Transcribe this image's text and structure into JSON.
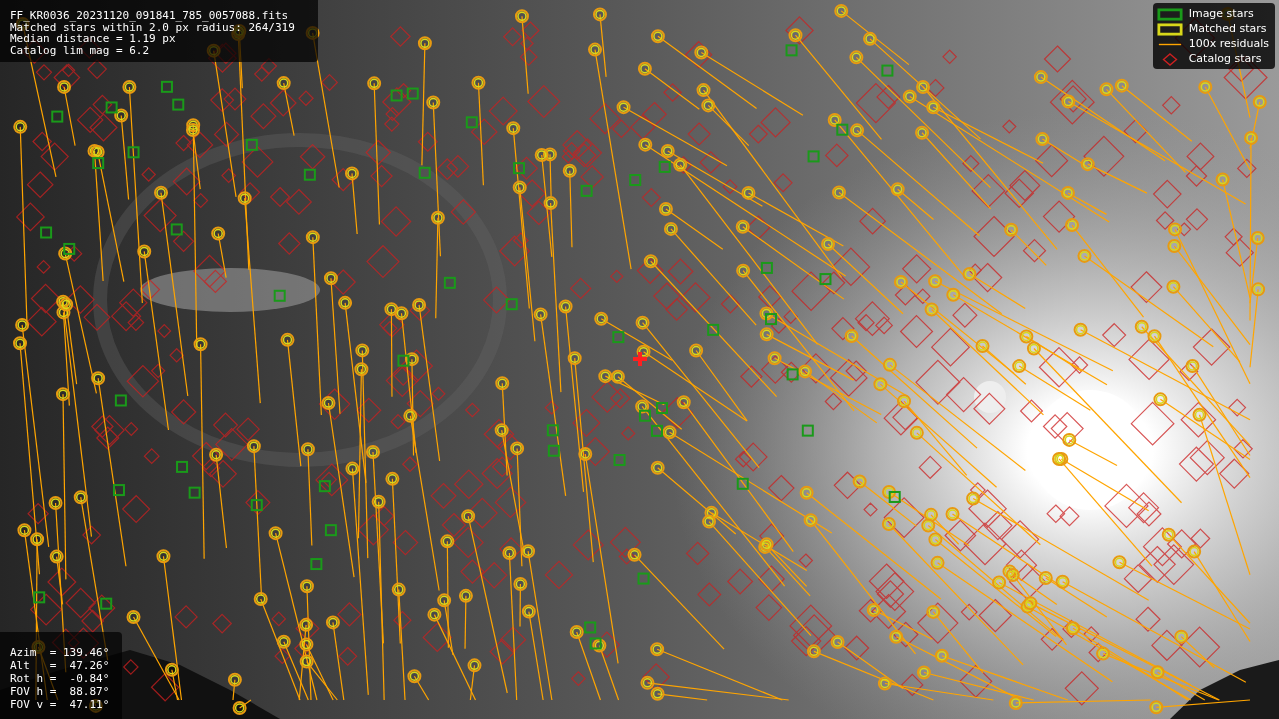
{
  "file_info": [
    "FF_KR0036_20231120_091841_785_0057088.fits",
    "Matched stars within 2.0 px radius: 264/319",
    "Median distance = 1.19 px",
    "Catalog lim mag = 6.2"
  ],
  "legend": [
    {
      "label": "Image stars",
      "color": "#1a9a1a"
    },
    {
      "kind": "matched",
      "label": "Matched stars",
      "color": "#d8d81a"
    },
    {
      "kind": "residual",
      "label": "100x residuals",
      "color": "#ffa500"
    },
    {
      "kind": "catalog",
      "label": "Catalog stars",
      "color": "#cc2020"
    }
  ],
  "pointing": [
    "Azim  = 139.46°",
    "Alt   =  47.26°",
    "Rot h =  -0.84°",
    "FOV h =  88.87°",
    "FOV v =  47.11°"
  ]
}
